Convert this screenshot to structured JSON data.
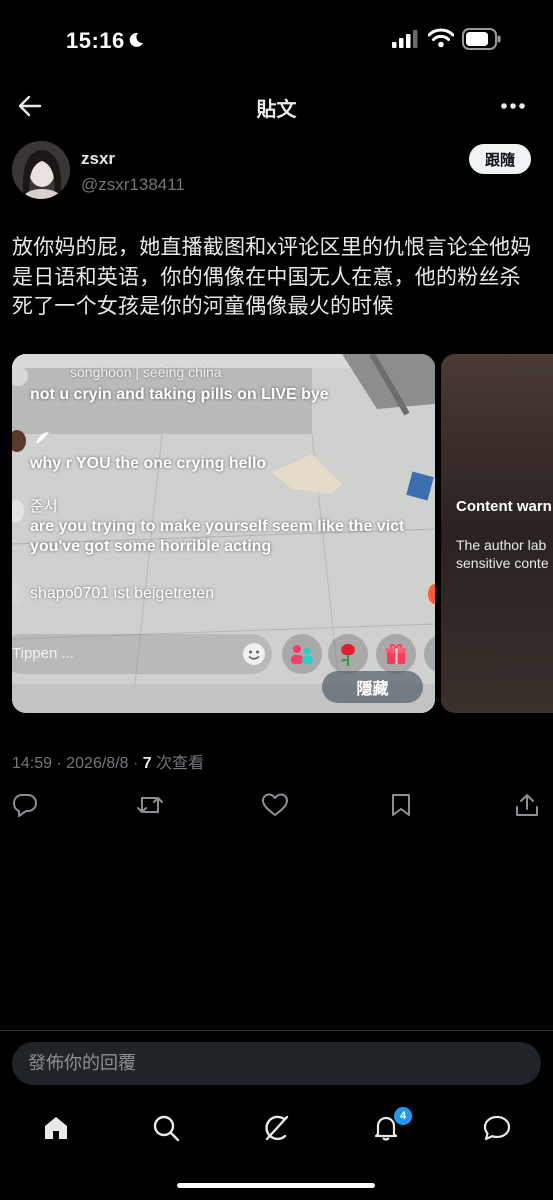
{
  "status_bar": {
    "time": "15:16"
  },
  "header": {
    "title": "貼文"
  },
  "author": {
    "display_name": "zsxr",
    "handle": "@zsxr138411",
    "follow_label": "跟隨"
  },
  "post": {
    "text": "放你妈的屁，她直播截图和x评论区里的仇恨言论全他妈是日语和英语，你的偶像在中国无人在意，他的粉丝杀死了一个女孩是你的河童偶像最火的时候",
    "media": [
      {
        "comments": [
          {
            "user": "songhoon | seeing china",
            "text": "not u cryin and taking pills on LIVE bye"
          },
          {
            "user": "",
            "text": "why r YOU the one crying hello"
          },
          {
            "user": "준서",
            "text": "are you trying to make yourself seem like the vict",
            "text2": "you've got some horrible acting"
          },
          {
            "user": "",
            "text": "shapo0701 ist beigetreten"
          }
        ],
        "input_placeholder": "Tippen ...",
        "hide_label": "隱藏"
      },
      {
        "warning_title": "Content warn",
        "warning_body_1": "The author lab",
        "warning_body_2": "sensitive conte"
      }
    ],
    "timestamp": "14:59 · 2026/8/8 · ",
    "views_count": "7",
    "views_label": " 次查看"
  },
  "reply": {
    "placeholder": "發佈你的回覆"
  },
  "tabbar": {
    "notifications_badge": "4"
  }
}
